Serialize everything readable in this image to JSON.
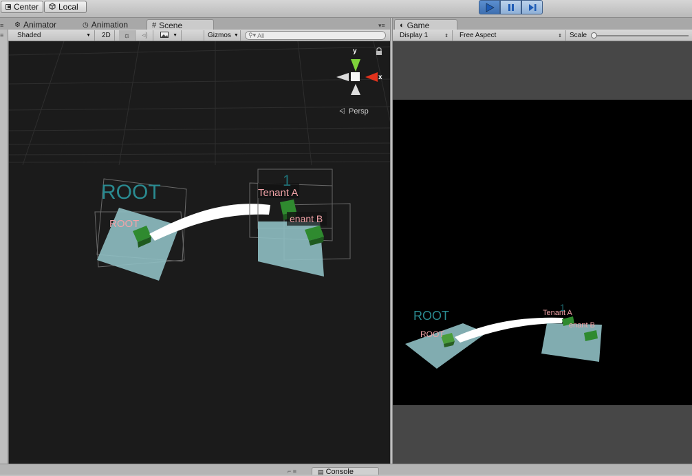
{
  "toolbar": {
    "center_label": "Center",
    "local_label": "Local",
    "playback": {
      "play": "play-icon",
      "pause": "pause-icon",
      "step": "step-icon",
      "play_active": true
    }
  },
  "tabs": {
    "animator": "Animator",
    "animation": "Animation",
    "scene": "Scene",
    "game": "Game"
  },
  "scene_toolbar": {
    "draw_mode": "Shaded",
    "mode_2d": "2D",
    "gizmos": "Gizmos",
    "search_placeholder": "All"
  },
  "scene_view": {
    "gizmo": {
      "y": "y",
      "x": "x",
      "projection": "Persp"
    },
    "labels": {
      "root_big": "ROOT",
      "root_small": "ROOT",
      "tenant_a": "Tenant A",
      "tenant_b": "enant B",
      "tenant_num": "1"
    }
  },
  "game_toolbar": {
    "display": "Display 1",
    "aspect": "Free Aspect",
    "scale_label": "Scale"
  },
  "game_view": {
    "labels": {
      "root_big": "ROOT",
      "root_small": "ROOT",
      "tenant_a": "Tenant A",
      "tenant_b": "enant B",
      "tenant_num": "1"
    }
  },
  "bottom": {
    "console_label": "Console"
  },
  "colors": {
    "scene_bg": "#1b1b1b",
    "game_bg": "#474747",
    "plane": "#8fbfc3",
    "cube": "#2f7f2f",
    "label_pink": "#f2a3a8",
    "label_teal": "#2e8e95",
    "axis_x": "#e2321c",
    "axis_y": "#7ed23a"
  }
}
